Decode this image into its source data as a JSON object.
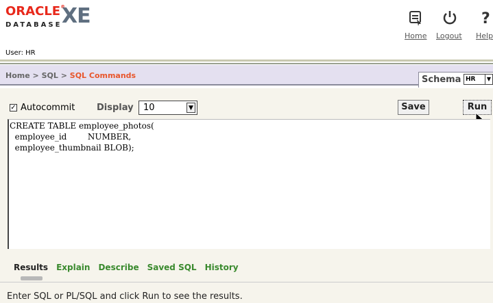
{
  "header": {
    "logo_oracle": "ORACLE",
    "logo_database": "DATABASE",
    "logo_xe": "XE",
    "home_label": "Home",
    "logout_label": "Logout",
    "help_label": "Help",
    "user_line": "User: HR"
  },
  "breadcrumb": {
    "home": "Home",
    "sql": "SQL",
    "current": "SQL Commands"
  },
  "schema": {
    "label": "Schema",
    "value": "HR"
  },
  "toolbar": {
    "autocommit_label": "Autocommit",
    "autocommit_checked": true,
    "display_label": "Display",
    "display_value": "10",
    "save_label": "Save",
    "run_label": "Run"
  },
  "editor": {
    "code": "CREATE TABLE employee_photos(\n  employee_id        NUMBER,\n  employee_thumbnail BLOB);"
  },
  "results": {
    "tabs": [
      "Results",
      "Explain",
      "Describe",
      "Saved SQL",
      "History"
    ],
    "active_tab": "Results",
    "message": "Enter SQL or PL/SQL and click Run to see the results."
  },
  "colors": {
    "accent_red": "#e8281b",
    "breadcrumb_current": "#e8562b",
    "tab_green": "#3a8a2e",
    "band": "#e4e0f0"
  }
}
